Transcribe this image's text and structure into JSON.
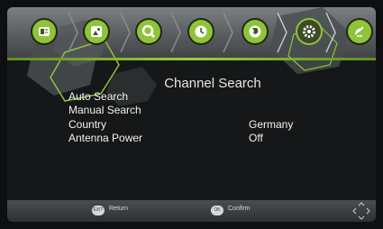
{
  "tabs": [
    {
      "icon": "info-card-icon",
      "color": "#f2f2f2",
      "active": false
    },
    {
      "icon": "picture-icon",
      "color": "#f2f2f2",
      "active": false
    },
    {
      "icon": "search-icon",
      "color": "#f2f2f2",
      "active": false
    },
    {
      "icon": "clock-icon",
      "color": "#f2f2f2",
      "active": false
    },
    {
      "icon": "globe-icon",
      "color": "#f2f2f2",
      "active": false
    },
    {
      "icon": "gear-icon",
      "color": "#f2f2f2",
      "active": true
    },
    {
      "icon": "satellite-dish-icon",
      "color": "#f2f2f2",
      "active": false
    }
  ],
  "accent": "#8fc43a",
  "title": "Channel Search",
  "menu": [
    {
      "label": "Auto Search",
      "value": ""
    },
    {
      "label": "Manual Search",
      "value": ""
    },
    {
      "label": "Country",
      "value": "Germany"
    },
    {
      "label": "Antenna Power",
      "value": "Off"
    }
  ],
  "footer": {
    "return_key": "EXIT",
    "return_label": "Return",
    "confirm_key": "OK",
    "confirm_label": "Confirm",
    "nav_icon": "dpad-icon"
  }
}
